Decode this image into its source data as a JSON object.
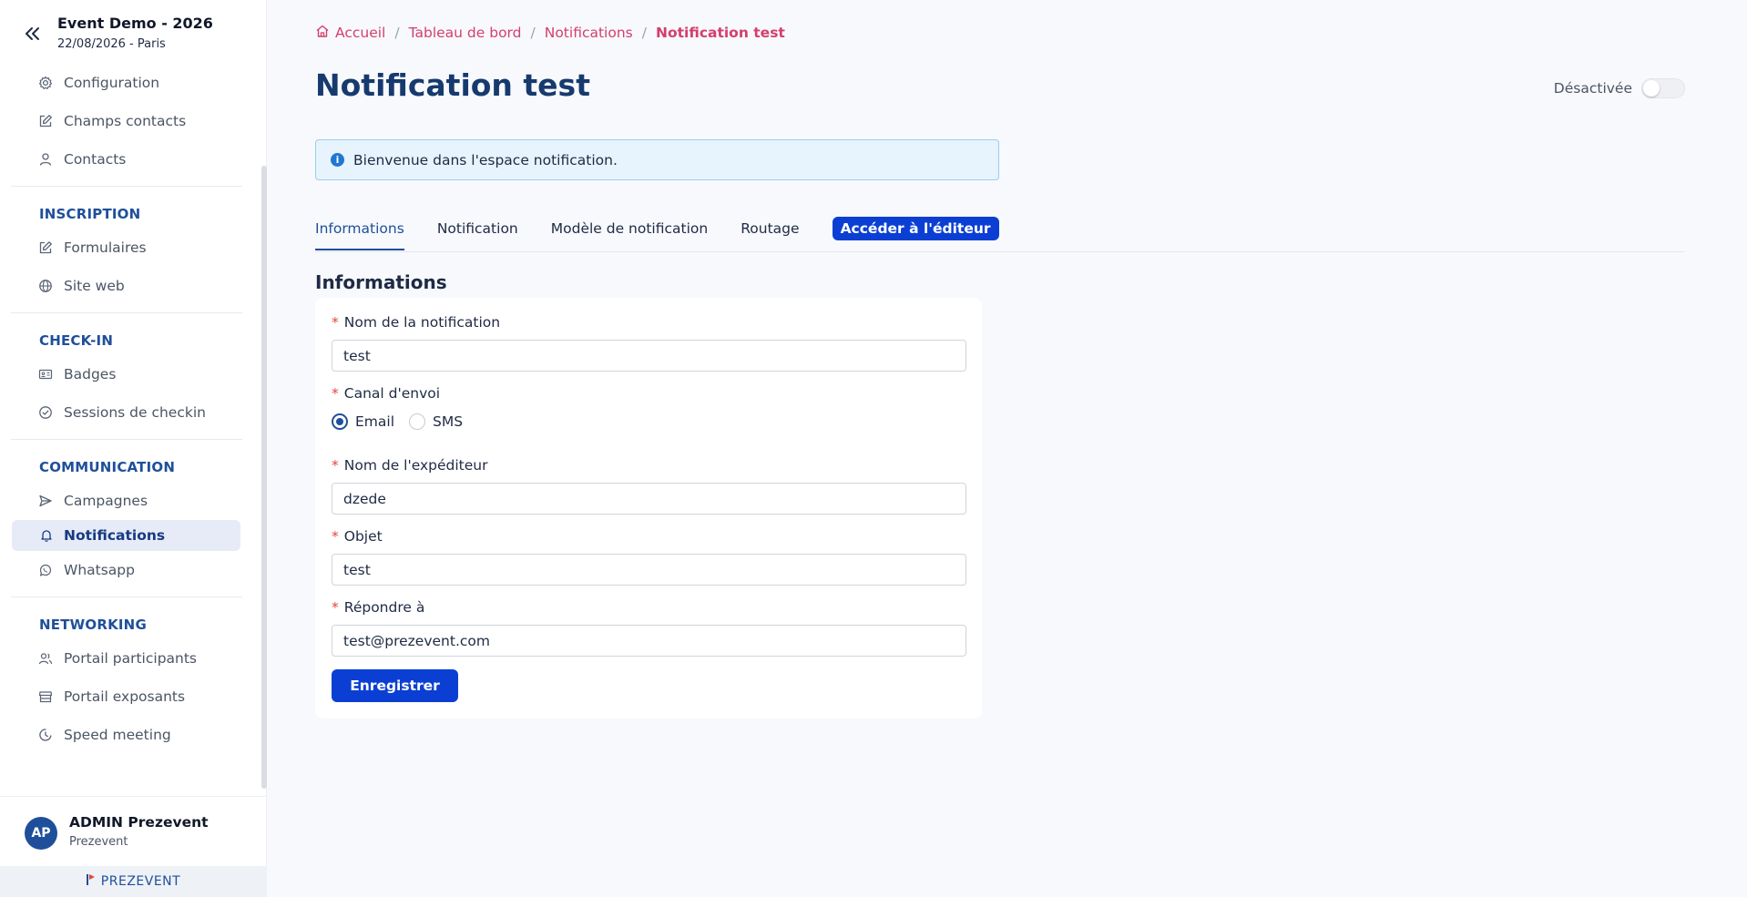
{
  "event": {
    "title": "Event Demo - 2026",
    "subtitle": "22/08/2026 - Paris"
  },
  "sidebar": {
    "top_items": [
      {
        "label": "Configuration",
        "icon": "gear-icon"
      },
      {
        "label": "Champs contacts",
        "icon": "edit-icon"
      },
      {
        "label": "Contacts",
        "icon": "user-icon"
      }
    ],
    "sections": [
      {
        "title": "INSCRIPTION",
        "items": [
          {
            "label": "Formulaires",
            "icon": "edit-icon"
          },
          {
            "label": "Site web",
            "icon": "globe-icon"
          }
        ]
      },
      {
        "title": "CHECK-IN",
        "items": [
          {
            "label": "Badges",
            "icon": "id-card-icon"
          },
          {
            "label": "Sessions de checkin",
            "icon": "check-circle-icon"
          }
        ]
      },
      {
        "title": "COMMUNICATION",
        "items": [
          {
            "label": "Campagnes",
            "icon": "send-icon"
          },
          {
            "label": "Notifications",
            "icon": "bell-icon",
            "active": true
          },
          {
            "label": "Whatsapp",
            "icon": "whatsapp-icon"
          }
        ]
      },
      {
        "title": "NETWORKING",
        "items": [
          {
            "label": "Portail participants",
            "icon": "users-icon"
          },
          {
            "label": "Portail exposants",
            "icon": "store-icon"
          },
          {
            "label": "Speed meeting",
            "icon": "clock-icon"
          }
        ]
      }
    ]
  },
  "user": {
    "initials": "AP",
    "name": "ADMIN Prezevent",
    "org": "Prezevent"
  },
  "brand": {
    "name": "PREZEVENT"
  },
  "breadcrumb": {
    "home": "Accueil",
    "dashboard": "Tableau de bord",
    "notifications": "Notifications",
    "current": "Notification test"
  },
  "page": {
    "title": "Notification test"
  },
  "status_toggle": {
    "label": "Désactivée"
  },
  "alert": {
    "text": "Bienvenue dans l'espace notification."
  },
  "tabs": {
    "informations": "Informations",
    "notification": "Notification",
    "modele": "Modèle de notification",
    "routage": "Routage",
    "editor_button": "Accéder à l'éditeur"
  },
  "form": {
    "section_title": "Informations",
    "required_mark": "*",
    "name_label": "Nom de la notification",
    "name_value": "test",
    "channel_label": "Canal d'envoi",
    "channel_email": "Email",
    "channel_sms": "SMS",
    "channel_selected": "Email",
    "sender_label": "Nom de l'expéditeur",
    "sender_value": "dzede",
    "subject_label": "Objet",
    "subject_value": "test",
    "reply_label": "Répondre à",
    "reply_value": "test@prezevent.com",
    "save_label": "Enregistrer"
  },
  "colors": {
    "accent": "#0b3fd4",
    "primary_dark": "#173a6e",
    "breadcrumb": "#d43f6b",
    "active_nav_bg": "#e6ebf7",
    "required": "#e0463e"
  }
}
